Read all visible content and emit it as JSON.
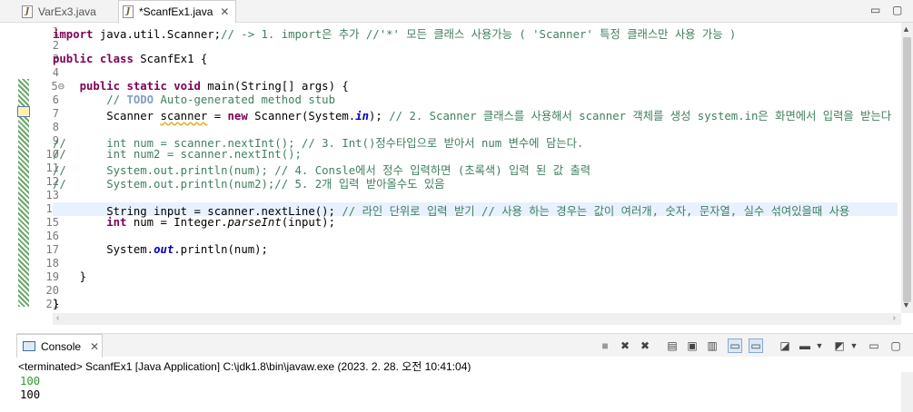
{
  "tabs": [
    {
      "label": "VarEx3.java",
      "active": false
    },
    {
      "label": "*ScanfEx1.java",
      "active": true
    }
  ],
  "window_controls": {
    "minimize": "▭",
    "maximize": "▢"
  },
  "line_numbers": [
    "1",
    "2",
    "3",
    "4",
    "5⊖",
    "6",
    "7",
    "8",
    "9",
    "10",
    "11",
    "12",
    "13",
    "14",
    "15",
    "16",
    "17",
    "18",
    "19",
    "20",
    "21"
  ],
  "code": {
    "l1_kw": "import",
    "l1_a": " java.util.Scanner;",
    "l1_cm": "// -> 1. import은 추가 //'*' 모든 클래스 사용가능 ( 'Scanner' 특정 클래스만 사용 가능 )",
    "l3_kw1": "public",
    "l3_kw2": "class",
    "l3_a": " ScanfEx1 {",
    "l5_kw1": "public",
    "l5_kw2": "static",
    "l5_kw3": "void",
    "l5_a": " main(String[] args) {",
    "l6_cm1": "// ",
    "l6_todo": "TODO",
    "l6_cm2": " Auto-generated method stub",
    "l7_a": "Scanner ",
    "l7_var": "scanner",
    "l7_b": " = ",
    "l7_kw": "new",
    "l7_c": " Scanner(System.",
    "l7_field": "in",
    "l7_d": "); ",
    "l7_cm": "// 2. Scanner 클래스를 사용해서 scanner 객체를 생성 system.in은 화면에서 입력을 받는다",
    "l9": "//      int num = scanner.nextInt(); // 3. Int()정수타입으로 받아서 num 변수에 담는다.",
    "l10": "//      int num2 = scanner.nextInt();",
    "l11": "//      System.out.println(num); // 4. Consle에서 정수 입력하면 (초록색) 입력 된 값 출력",
    "l12": "//      System.out.println(num2);// 5. 2개 입력 받아올수도 있음",
    "l14_a": "String input = scanner.nextLine(); ",
    "l14_cm": "// 라인 단위로 입력 받기 // 사용 하는 경우는 값이 여러개, 숫자, 문자열, 실수 섞여있을때 사용",
    "l15_kw": "int",
    "l15_a": " num = Integer.",
    "l15_static": "parseInt",
    "l15_b": "(input);",
    "l17_a": "System.",
    "l17_field": "out",
    "l17_b": ".println(num);",
    "l19": "}",
    "l21": "}"
  },
  "console": {
    "tab_label": "Console",
    "close": "✕",
    "status": "<terminated> ScanfEx1 [Java Application] C:\\jdk1.8\\bin\\javaw.exe (2023. 2. 28. 오전 10:41:04)",
    "output": [
      "100",
      "100"
    ]
  },
  "colors": {
    "keyword": "#7f0055",
    "comment": "#3f7f5f",
    "field": "#0000c0",
    "input_echo": "#2e9a2e",
    "current_line": "#e8f2fe"
  }
}
